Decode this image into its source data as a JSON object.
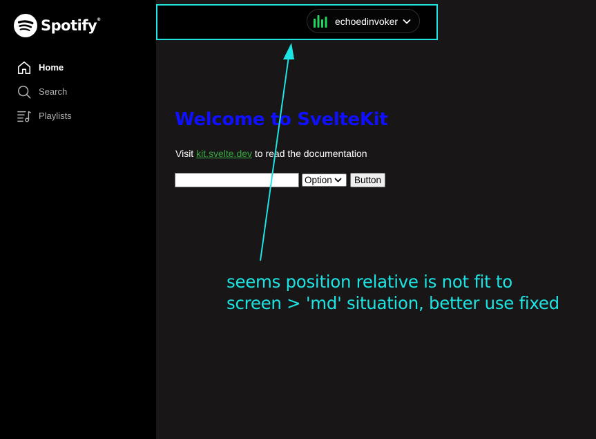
{
  "brand": {
    "name": "Spotify",
    "trademark": "®",
    "color": "#1ED760",
    "icon": "spotify-logo-icon"
  },
  "sidebar": {
    "items": [
      {
        "label": "Home",
        "icon": "home-icon",
        "active": true
      },
      {
        "label": "Search",
        "icon": "search-icon",
        "active": false
      },
      {
        "label": "Playlists",
        "icon": "playlists-icon",
        "active": false
      }
    ]
  },
  "header": {
    "user_name": "echoedinvoker",
    "user_icon": "equalizer-icon",
    "dropdown_icon": "chevron-down-icon"
  },
  "main": {
    "title": "Welcome to SvelteKit",
    "visit_prefix": "Visit ",
    "visit_link": "kit.svelte.dev",
    "visit_suffix": " to read the documentation",
    "input_value": "",
    "select_value": "Option",
    "button_label": "Button"
  },
  "annotation": {
    "line1": "seems position relative is not fit to",
    "line2": "screen > 'md' situation, better use fixed",
    "color": "#1EE3E3"
  },
  "colors": {
    "sidebar_bg": "#000000",
    "main_bg": "#181616",
    "title": "#1010FF",
    "link": "#37A843",
    "highlight": "#1EE3E3"
  }
}
